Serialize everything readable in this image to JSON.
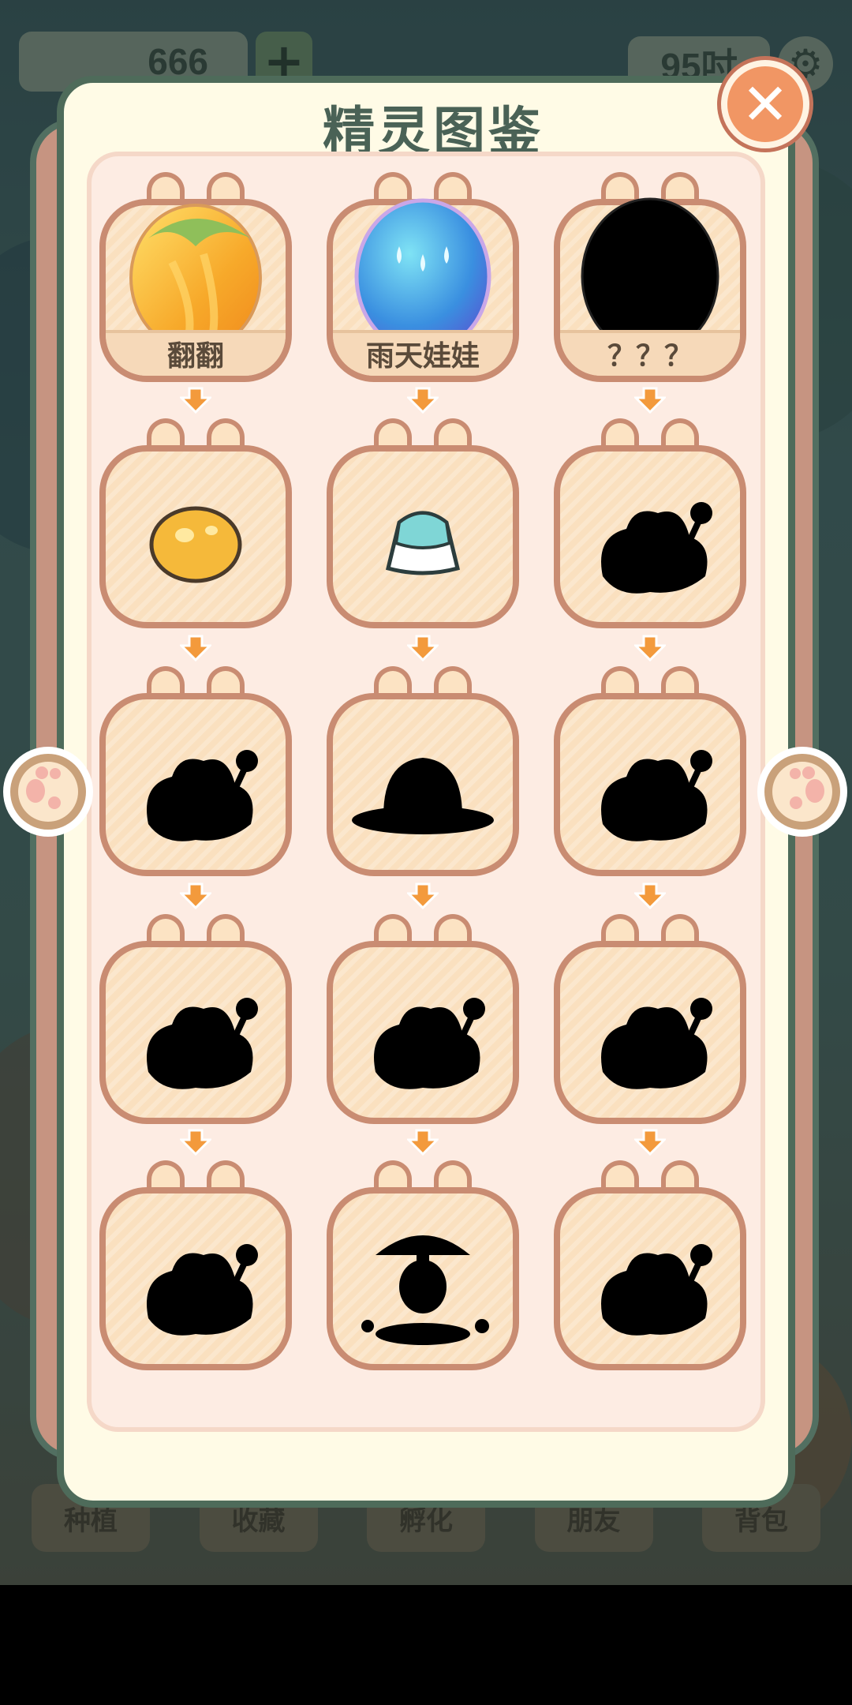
{
  "hud": {
    "coins": "666",
    "plus_label": "+",
    "time": "95吋",
    "gear_glyph": "⚙"
  },
  "bottom_nav": [
    {
      "label": "种植"
    },
    {
      "label": "收藏"
    },
    {
      "label": "孵化"
    },
    {
      "label": "朋友"
    },
    {
      "label": "背包"
    }
  ],
  "dialog": {
    "title": "精灵图鉴",
    "close_glyph": "✕"
  },
  "spirits": [
    {
      "name": "翻翻",
      "icon": "golden-leaf-egg",
      "unlocked": true
    },
    {
      "name": "雨天娃娃",
      "icon": "blue-rain-egg",
      "unlocked": true
    },
    {
      "name": "？？？",
      "icon": "mystery-egg-silhouette",
      "unlocked": false
    },
    {
      "name": "",
      "icon": "golden-blob",
      "unlocked": true
    },
    {
      "name": "",
      "icon": "jelly-pudding",
      "unlocked": true
    },
    {
      "name": "",
      "icon": "creature-silhouette",
      "unlocked": false
    },
    {
      "name": "",
      "icon": "creature-silhouette",
      "unlocked": false
    },
    {
      "name": "",
      "icon": "hat-silhouette",
      "unlocked": false
    },
    {
      "name": "",
      "icon": "creature-silhouette",
      "unlocked": false
    },
    {
      "name": "",
      "icon": "creature-silhouette",
      "unlocked": false
    },
    {
      "name": "",
      "icon": "creature-silhouette",
      "unlocked": false
    },
    {
      "name": "",
      "icon": "creature-silhouette",
      "unlocked": false
    },
    {
      "name": "",
      "icon": "creature-silhouette",
      "unlocked": false
    },
    {
      "name": "",
      "icon": "umbrella-silhouette",
      "unlocked": false
    },
    {
      "name": "",
      "icon": "creature-silhouette",
      "unlocked": false
    }
  ],
  "colors": {
    "panel_border": "#4e6b5a",
    "card_border": "#c98c72",
    "card_fill": "#fae0bf",
    "close_button": "#f19664",
    "arrow_accent": "#f39a3c"
  }
}
